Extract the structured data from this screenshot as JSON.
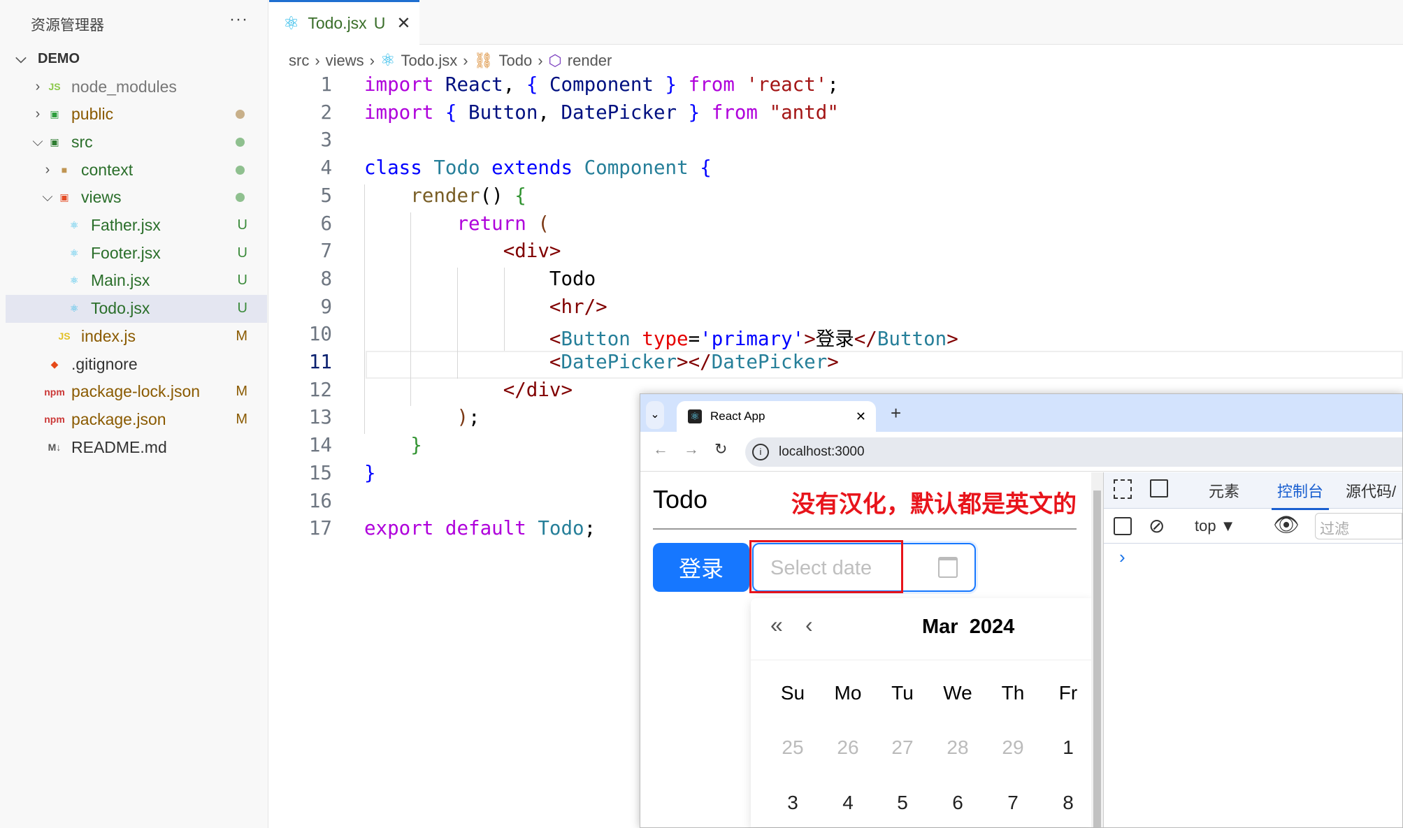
{
  "explorer": {
    "title": "资源管理器",
    "more": "···",
    "root": "DEMO",
    "items": [
      {
        "label": "node_modules",
        "badge": ""
      },
      {
        "label": "public",
        "badge": ""
      },
      {
        "label": "src",
        "badge": ""
      },
      {
        "label": "context",
        "badge": ""
      },
      {
        "label": "views",
        "badge": ""
      },
      {
        "label": "Father.jsx",
        "badge": "U"
      },
      {
        "label": "Footer.jsx",
        "badge": "U"
      },
      {
        "label": "Main.jsx",
        "badge": "U"
      },
      {
        "label": "Todo.jsx",
        "badge": "U"
      },
      {
        "label": "index.js",
        "badge": "M"
      },
      {
        "label": ".gitignore",
        "badge": ""
      },
      {
        "label": "package-lock.json",
        "badge": "M"
      },
      {
        "label": "package.json",
        "badge": "M"
      },
      {
        "label": "README.md",
        "badge": ""
      }
    ]
  },
  "editor": {
    "tab": {
      "label": "Todo.jsx",
      "badge": "U"
    },
    "breadcrumb": [
      "src",
      "views",
      "Todo.jsx",
      "Todo",
      "render"
    ],
    "line_numbers": [
      "1",
      "2",
      "3",
      "4",
      "5",
      "6",
      "7",
      "8",
      "9",
      "10",
      "11",
      "12",
      "13",
      "14",
      "15",
      "16",
      "17"
    ]
  },
  "browser": {
    "tab_title": "React App",
    "new_tab": "+",
    "url": "localhost:3000",
    "page": {
      "heading": "Todo",
      "annotation": "没有汉化，默认都是英文的",
      "login_button": "登录",
      "date_placeholder": "Select date",
      "calendar": {
        "month": "Mar",
        "year": "2024",
        "weekdays": [
          "Su",
          "Mo",
          "Tu",
          "We",
          "Th",
          "Fr"
        ],
        "rows": [
          [
            "25",
            "26",
            "27",
            "28",
            "29",
            "1"
          ],
          [
            "3",
            "4",
            "5",
            "6",
            "7",
            "8"
          ]
        ]
      }
    },
    "devtools": {
      "tabs": [
        "元素",
        "控制台",
        "源代码/"
      ],
      "context": "top",
      "filter_placeholder": "过滤",
      "prompt": "›"
    }
  },
  "colors": {
    "accent": "#1677ff",
    "annotation": "#e8141b"
  }
}
